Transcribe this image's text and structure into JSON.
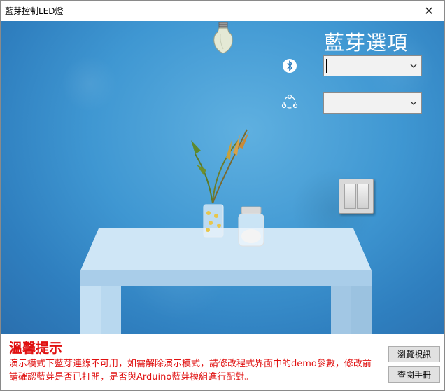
{
  "window": {
    "title": "藍芽控制LED燈",
    "close_glyph": "✕"
  },
  "panel": {
    "title": "藍芽選項",
    "bluetooth_combo_value": "",
    "network_combo_value": ""
  },
  "icons": {
    "bulb": "lightbulb-icon",
    "bluetooth": "bluetooth-icon",
    "network": "network-share-icon",
    "switch": "wall-switch-icon",
    "dropdown": "chevron-down-icon"
  },
  "tip": {
    "title": "溫馨提示",
    "text": "演示模式下藍芽連線不可用，如需解除演示模式，請修改程式界面中的demo參數，修改前請確認藍芽是否已打開，是否與Arduino藍芽模組進行配對。"
  },
  "buttons": {
    "browse": "瀏覽視訊",
    "manual": "查閱手冊"
  },
  "colors": {
    "tip_red": "#e01010",
    "wall_blue": "#3f97d2"
  }
}
